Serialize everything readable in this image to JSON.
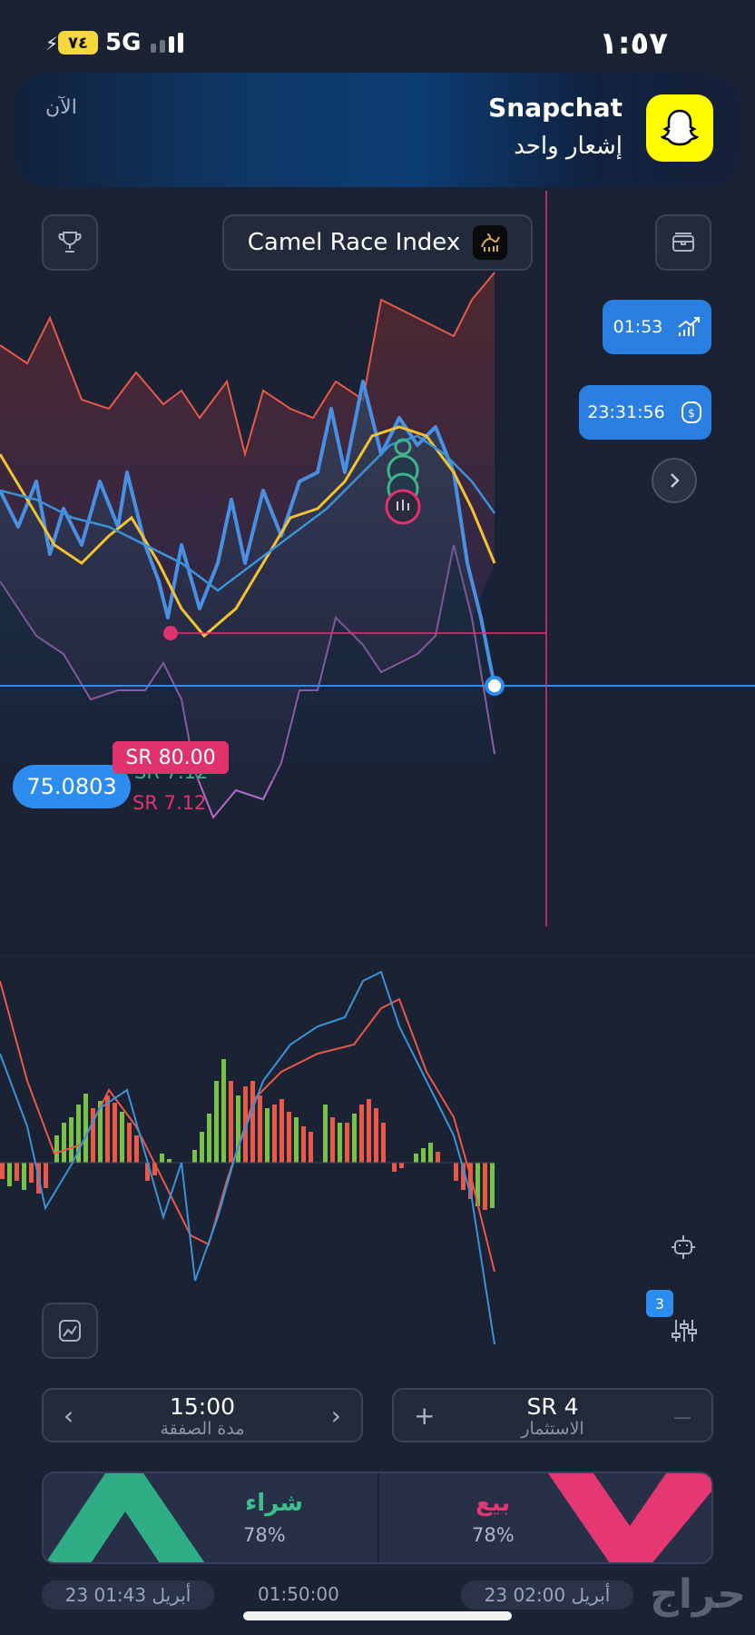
{
  "status": {
    "battery": "٧٤",
    "network": "5G",
    "time": "١:٥٧"
  },
  "notification": {
    "app": "Snapchat",
    "message": "إشعار واحد",
    "time": "الآن",
    "icon": "ghost-icon"
  },
  "toolbar": {
    "asset": "Camel Race Index",
    "left_icon": "trophy-icon",
    "right_icon": "portfolio-icon"
  },
  "timers": {
    "expiry": "01:53",
    "server_time": "23:31:56"
  },
  "chart": {
    "current_price": "75.0803",
    "target_tag": "SR 80.00",
    "green_label": "SR 7.12",
    "red_label": "SR 7.12",
    "colors": {
      "price": "#4a90e2",
      "ma_yellow": "#f2c230",
      "ma_blue": "#3a93d9",
      "band_upper": "#e8594a",
      "band_lower": "#b56cc9",
      "accent_red": "#e0336e",
      "accent_green": "#3fb38a"
    }
  },
  "indicator": {
    "badge": "3"
  },
  "controls": {
    "duration_value": "15:00",
    "duration_label": "مدة الصفقة",
    "investment_value": "SR 4",
    "investment_label": "الاستثمار",
    "plus": "+",
    "minus": "—",
    "prev": "‹",
    "next": "›"
  },
  "trade": {
    "buy_label": "شراء",
    "buy_pct": "78%",
    "sell_label": "بيع",
    "sell_pct": "78%"
  },
  "timeline": {
    "left": "23 أبريل 01:43",
    "middle": "01:50:00",
    "right": "23 أبريل 02:00"
  },
  "watermark": "حراج"
}
